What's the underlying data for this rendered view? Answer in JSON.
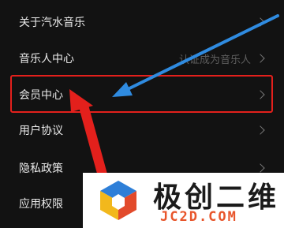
{
  "settings": {
    "items": [
      {
        "label": "关于汽水音乐",
        "value": ""
      },
      {
        "label": "音乐人中心",
        "value": "认证成为音乐人"
      },
      {
        "label": "会员中心",
        "value": ""
      },
      {
        "label": "用户协议",
        "value": ""
      },
      {
        "label": "隐私政策",
        "value": ""
      },
      {
        "label": "应用权限",
        "value": ""
      }
    ]
  },
  "annotations": {
    "highlight_color": "#e3201c",
    "blue_arrow_color": "#2f8be0",
    "red_arrow_color": "#e3201c"
  },
  "watermark": {
    "text": "极创二维",
    "domain": "JC2D.COM",
    "accent_color": "#e8552b"
  }
}
